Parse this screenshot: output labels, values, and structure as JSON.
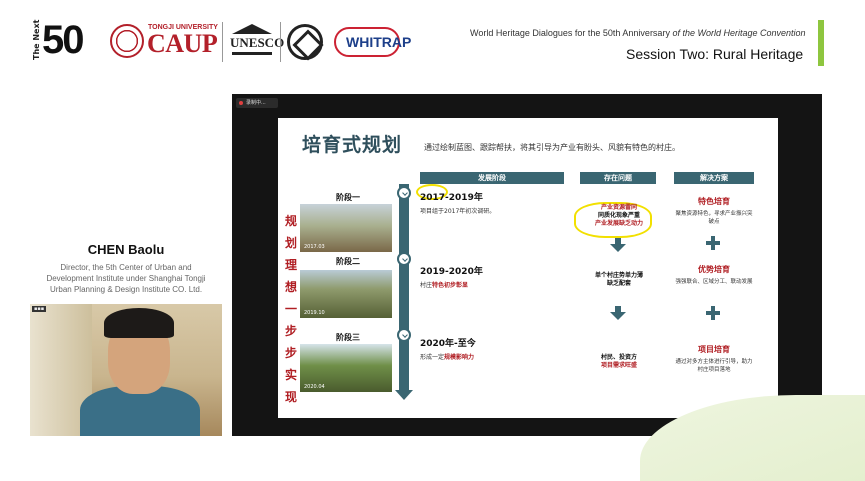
{
  "header": {
    "logo_next_label": "The Next",
    "logo_50_label": "50",
    "university_label": "TONGJI UNIVERSITY",
    "caup_label": "CAUP",
    "unesco_label": "UNESCO",
    "whitrap_label": "WHITRAP",
    "event_title_part1": "World Heritage Dialogues for the 50th Anniversary",
    "event_title_part2": "of the World Heritage Convention",
    "session_title": "Session Two: Rural Heritage"
  },
  "speaker": {
    "name": "CHEN Baolu",
    "role_line1": "Director, the 5th Center of Urban and",
    "role_line2": "Development Institute under Shanghai Tongji",
    "role_line3": "Urban Planning & Design Institute CO. Ltd."
  },
  "recording_label": "录制中...",
  "slide": {
    "title": "培育式规划",
    "subtitle": "通过绘制蓝图、跟踪帮扶，将其引导为产业有盼头、风貌有特色的村庄。",
    "vertical_text": "规划理想一步步实现",
    "columns": {
      "stage": "发展阶段",
      "problems": "存在问题",
      "solutions": "解决方案"
    },
    "stages": [
      {
        "label": "阶段一",
        "photo_date": "2017.03",
        "years": "2017-2019年",
        "desc_plain": "项目组于2017年初次调研。",
        "desc_red": "",
        "problem_lines": [
          "产业资源雷同",
          "同质化现象严重",
          "产业发展缺乏动力"
        ],
        "solution_title": "特色培育",
        "solution_desc": "聚焦资源特色，寻求产业振兴突破点"
      },
      {
        "label": "阶段二",
        "photo_date": "2019.10",
        "years": "2019-2020年",
        "desc_plain": "村庄",
        "desc_red": "特色初步彰显",
        "problem_lines": [
          "单个村庄势单力薄",
          "缺乏配套"
        ],
        "solution_title": "优势培育",
        "solution_desc": "强强联合、区域分工、联动发展"
      },
      {
        "label": "阶段三",
        "photo_date": "2020.04",
        "years": "2020年-至今",
        "desc_plain": "形成一定",
        "desc_red": "规模影响力",
        "problem_lines": [
          "村民、投资方",
          "项目需求旺盛"
        ],
        "solution_title": "项目培育",
        "solution_desc": "通过对多方主体进行引导，助力村庄项目落地"
      }
    ]
  }
}
